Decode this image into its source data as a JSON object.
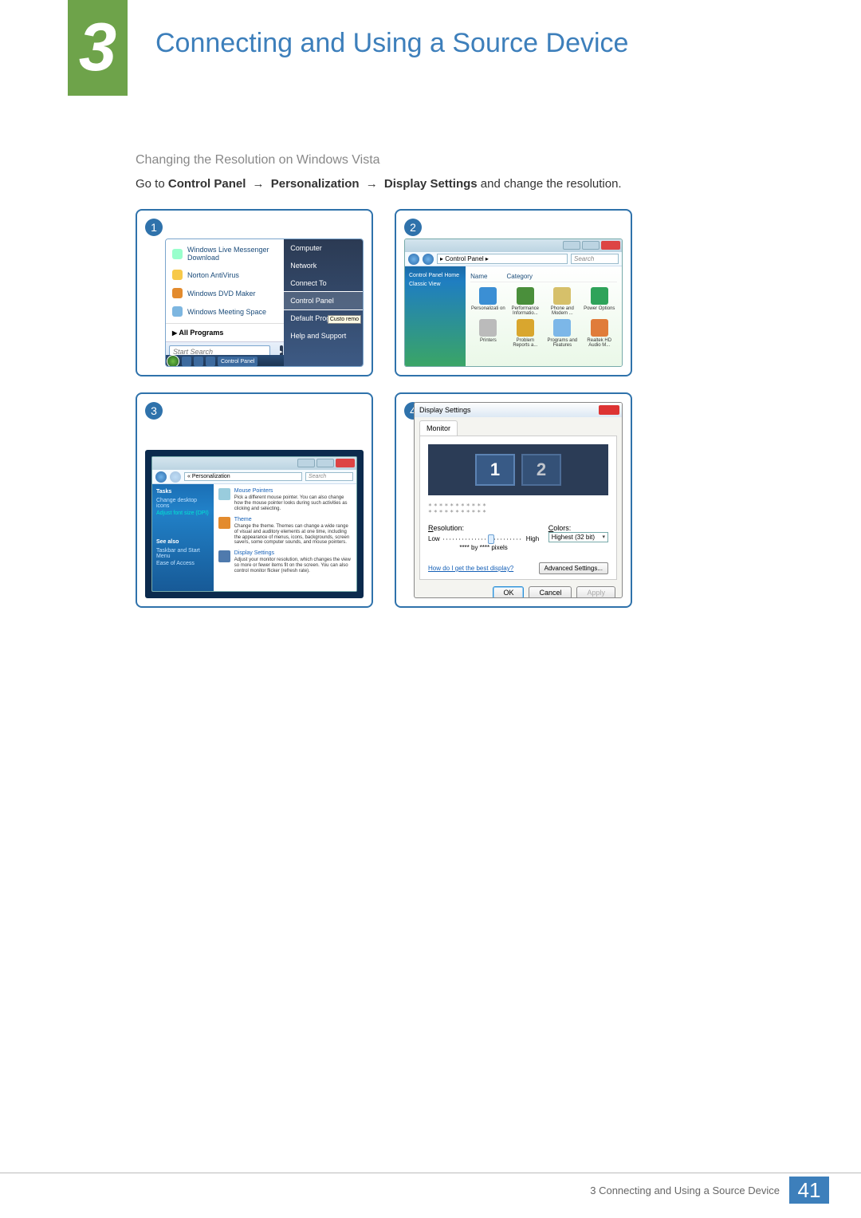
{
  "header": {
    "chapter_number": "3",
    "title": "Connecting and Using a Source Device"
  },
  "section_heading": "Changing the Resolution on Windows Vista",
  "instruction": {
    "pre": "Go to ",
    "b1": "Control Panel",
    "b2": "Personalization",
    "b3": "Display Settings",
    "post": " and change the resolution."
  },
  "steps": {
    "s1": "1",
    "s2": "2",
    "s3": "3",
    "s4": "4"
  },
  "start_menu": {
    "items": [
      "Windows Live Messenger Download",
      "Norton AntiVirus",
      "Windows DVD Maker",
      "Windows Meeting Space"
    ],
    "all_programs": "All Programs",
    "search_placeholder": "Start Search",
    "right": [
      "Computer",
      "Network",
      "Connect To",
      "Control Panel",
      "Default Programs",
      "Help and Support"
    ],
    "highlight_index": 3,
    "taskbar_label": "Control Panel",
    "tooltip": "Custo remo"
  },
  "control_panel": {
    "breadcrumb": "▸ Control Panel ▸",
    "search": "Search",
    "side": {
      "home": "Control Panel Home",
      "classic": "Classic View"
    },
    "columns": {
      "name": "Name",
      "category": "Category"
    },
    "items": [
      "Personalizati on",
      "Performance Informatio...",
      "Phone and Modem ...",
      "Power Options",
      "Printers",
      "Problem Reports a...",
      "Programs and Features",
      "Realtek HD Audio M..."
    ]
  },
  "personalization": {
    "crumb": "« Personalization",
    "search": "Search",
    "tasks_heading": "Tasks",
    "tasks": [
      "Change desktop icons",
      "Adjust font size (DPI)"
    ],
    "see_also": "See also",
    "see_links": [
      "Taskbar and Start Menu",
      "Ease of Access"
    ],
    "blocks": [
      {
        "title": "Mouse Pointers",
        "text": "Pick a different mouse pointer. You can also change how the mouse pointer looks during such activities as clicking and selecting."
      },
      {
        "title": "Theme",
        "text": "Change the theme. Themes can change a wide range of visual and auditory elements at one time, including the appearance of menus, icons, backgrounds, screen savers, some computer sounds, and mouse pointers."
      },
      {
        "title": "Display Settings",
        "text": "Adjust your monitor resolution, which changes the view so more or fewer items fit on the screen. You can also control monitor flicker (refresh rate)."
      }
    ]
  },
  "display_settings": {
    "title": "Display Settings",
    "tab": "Monitor",
    "monitor_1": "1",
    "monitor_2": "2",
    "identify": "***********\n***********",
    "resolution_label": "Resolution:",
    "low": "Low",
    "high": "High",
    "pixels": "**** by **** pixels",
    "colors_label": "Colors:",
    "colors_value": "Highest (32 bit)",
    "help_link": "How do I get the best display?",
    "advanced": "Advanced Settings...",
    "ok": "OK",
    "cancel": "Cancel",
    "apply": "Apply"
  },
  "footer": {
    "text": "3 Connecting and Using a Source Device",
    "page": "41"
  }
}
